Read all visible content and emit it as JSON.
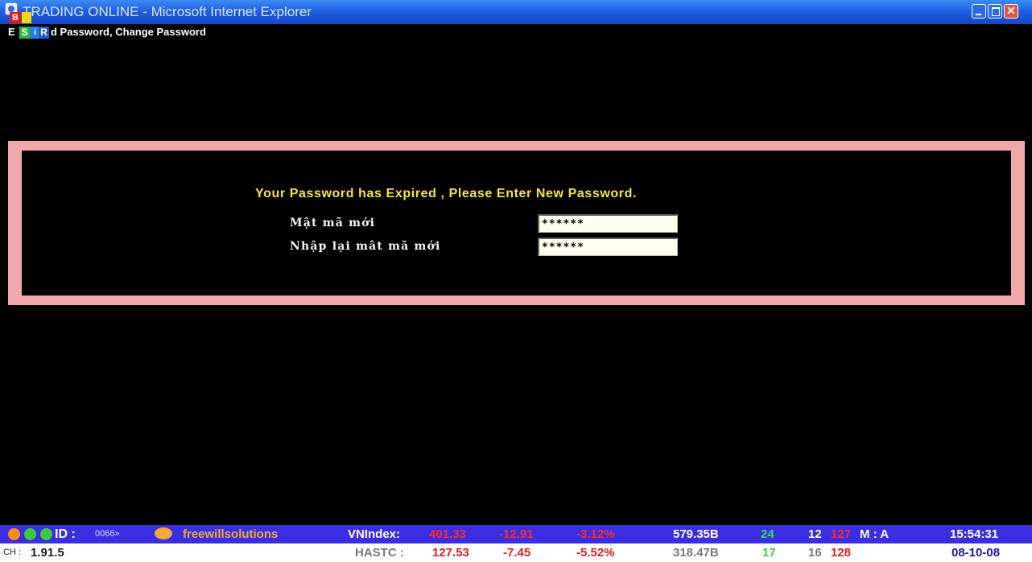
{
  "window": {
    "title": "TRADING ONLINE - Microsoft Internet Explorer",
    "close_symbol": "✕",
    "tag_b": "B"
  },
  "menu": {
    "prefix": "E",
    "badges": [
      "S",
      "i",
      "R"
    ],
    "text": "d Password, Change Password"
  },
  "dialog": {
    "heading": "Your Password has Expired , Please Enter New Password.",
    "new_password_label": "Mật mã mới",
    "new_password_value": "******",
    "confirm_password_label": "Nhập lại mât mã mới",
    "confirm_password_value": "******"
  },
  "status": {
    "id_label": "ID :",
    "id_value": "0066»",
    "brand": "freewillsolutions",
    "version_label": "CH :",
    "version_value": "1.91.5",
    "vnindex": {
      "label": "VNIndex:",
      "value": "401.33",
      "change": "-12.91",
      "percent": "-3.12%",
      "volume": "579.35B",
      "up": "24",
      "flat": "12",
      "down": "127",
      "mode": "M : A"
    },
    "hastc": {
      "label": "HASTC :",
      "value": "127.53",
      "change": "-7.45",
      "percent": "-5.52%",
      "volume": "318.47B",
      "up": "17",
      "flat": "16",
      "down": "128"
    },
    "time": "15:54:31",
    "date": "08-10-08"
  },
  "colors": {
    "dialog_border": "#f2a9ad",
    "heading": "#f2e73b",
    "status_bar": "#3a2ee0",
    "negative": "#ff2b2b",
    "positive": "#33e05a"
  }
}
